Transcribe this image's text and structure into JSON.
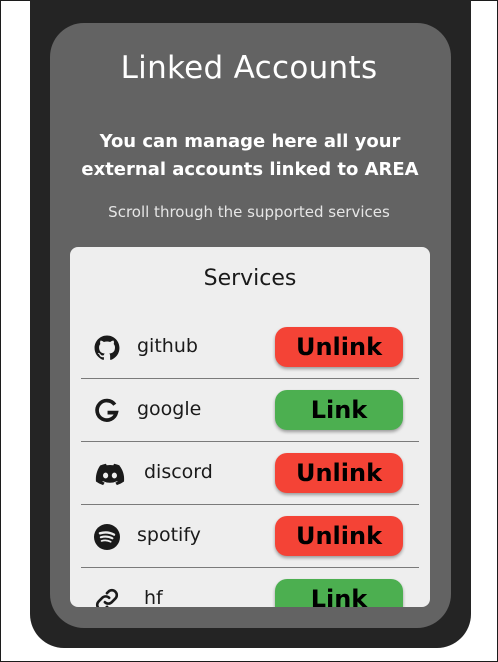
{
  "colors": {
    "background": "#ffffff",
    "phone": "#242424",
    "card": "#636363",
    "panel": "#eeeeee",
    "unlink": "#f44336",
    "link": "#4caf50"
  },
  "header": {
    "title": "Linked Accounts",
    "subtitle_line1": "You can manage here all your",
    "subtitle_line2": "external accounts linked to AREA",
    "hint": "Scroll through the supported services"
  },
  "services_panel": {
    "title": "Services",
    "items": [
      {
        "name": "github",
        "icon": "github-icon",
        "action": "Unlink",
        "linked": true
      },
      {
        "name": "google",
        "icon": "google-icon",
        "action": "Link",
        "linked": false
      },
      {
        "name": "discord",
        "icon": "discord-icon",
        "action": "Unlink",
        "linked": true
      },
      {
        "name": "spotify",
        "icon": "spotify-icon",
        "action": "Unlink",
        "linked": true
      },
      {
        "name": "hf",
        "icon": "link-icon",
        "action": "Link",
        "linked": false
      }
    ]
  }
}
